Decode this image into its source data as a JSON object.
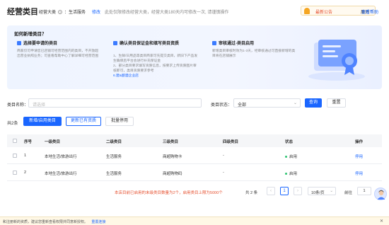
{
  "header": {
    "title": "经营类目",
    "biz_type_label": "经营大类",
    "biz_type_help_icon": "question-circle-icon",
    "biz_type_value": "：生活服务",
    "modify_label": "修改",
    "tip": "此处仅限修改经营大类，经营大类180天内可修改一次, 请谨慎操作",
    "notice_label": "最新公告",
    "notice_expand": "展开",
    "help_label": "查看帮助"
  },
  "guide": {
    "title": "如何新增类目？",
    "steps": [
      {
        "icon": "document-icon",
        "title": "选择要申请的类目",
        "body": "商家仅可申请您已店铺可经营范围内的类目，不开放超出营业执照业务；可查看帮助中心了解详细可经营范围"
      },
      {
        "icon": "wallet-icon",
        "title": "确认类目保证金和填写类目资质",
        "body": "1、生鲜/日用品等类目商家可先提交类目，新旧下产品发生确保后平台会进行补充保证金\n2、部分类目要求填写资质信息，按要求上传资质图片审核即可，类目资质要求参考",
        "link": "6.建&酿酒企业店"
      },
      {
        "icon": "check-badge-icon",
        "title": "审核通过-类目启用",
        "body": "新增类目审核时效为1-3天，经审核通过可直接新增的类目将在店铺展示"
      }
    ]
  },
  "filter": {
    "name_label": "类目名称：",
    "name_placeholder": "请选择",
    "status_label": "类目状态：",
    "status_value": "全部",
    "search_label": "查询",
    "reset_label": "重置"
  },
  "toolbar": {
    "total": "共2条",
    "add_label": "新增/启用类目",
    "update_label": "更新已有资质",
    "batch_label": "批量停用"
  },
  "table": {
    "headers": [
      "序号",
      "一级类目",
      "二级类目",
      "三级类目",
      "四级类目",
      "状态",
      "操作"
    ],
    "rows": [
      {
        "no": "1",
        "l1": "本地生活/旅游出行",
        "l2": "生活服务",
        "l3": "商超购物卡",
        "l4": "-",
        "status": "启用",
        "action": "停用"
      },
      {
        "no": "2",
        "l1": "本地生活/旅游出行",
        "l2": "生活服务",
        "l3": "商超购物码",
        "l4": "-",
        "status": "启用",
        "action": "停用"
      }
    ]
  },
  "pager": {
    "warning": "本店目前已启用的末级类目数量为2个，启用类目上限为5000个",
    "total": "共 2 条",
    "prev": "‹",
    "current": "1",
    "next": "›",
    "size": "10条/页",
    "goto_label": "前往",
    "goto_value": "1"
  },
  "bottom_bar": {
    "text": "和注册新的资质，建议您重新查看权限并同意新授权。",
    "link": "重置连接",
    "close": "✕"
  },
  "colors": {
    "primary": "#1a66ff",
    "warning": "#e6502f",
    "success": "#2ec472"
  }
}
